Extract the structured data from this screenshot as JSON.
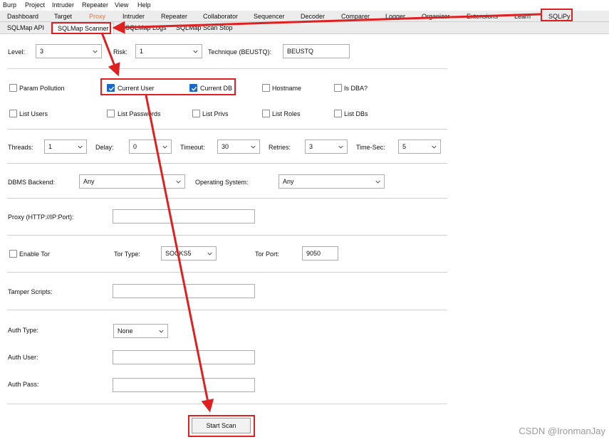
{
  "menubar": [
    "Burp",
    "Project",
    "Intruder",
    "Repeater",
    "View",
    "Help"
  ],
  "tabs": [
    "Dashboard",
    "Target",
    "Proxy",
    "Intruder",
    "Repeater",
    "Collaborator",
    "Sequencer",
    "Decoder",
    "Comparer",
    "Logger",
    "Organizer",
    "Extensions",
    "Learn",
    "SQLiPy"
  ],
  "subtabs": [
    "SQLMap API",
    "SQLMap Scanner",
    "SQLMap Logs",
    "SQLMap Scan Stop"
  ],
  "row1": {
    "level_label": "Level:",
    "level_value": "3",
    "risk_label": "Risk:",
    "risk_value": "1",
    "technique_label": "Technique (BEUSTQ):",
    "technique_value": "BEUSTQ"
  },
  "checks": {
    "param_pollution": "Param Pollution",
    "current_user": "Current User",
    "current_db": "Current DB",
    "hostname": "Hostname",
    "is_dba": "Is DBA?",
    "list_users": "List Users",
    "list_passwords": "List Passwords",
    "list_privs": "List Privs",
    "list_roles": "List Roles",
    "list_dbs": "List DBs"
  },
  "row3": {
    "threads_label": "Threads:",
    "threads_value": "1",
    "delay_label": "Delay:",
    "delay_value": "0",
    "timeout_label": "Timeout:",
    "timeout_value": "30",
    "retries_label": "Retries:",
    "retries_value": "3",
    "timesec_label": "Time-Sec:",
    "timesec_value": "5"
  },
  "dbms": {
    "label": "DBMS Backend:",
    "value": "Any",
    "os_label": "Operating System:",
    "os_value": "Any"
  },
  "proxy": {
    "label": "Proxy (HTTP://IP:Port):",
    "value": ""
  },
  "tor": {
    "enable_label": "Enable Tor",
    "type_label": "Tor Type:",
    "type_value": "SOCKS5",
    "port_label": "Tor Port:",
    "port_value": "9050"
  },
  "tamper": {
    "label": "Tamper Scripts:",
    "value": ""
  },
  "auth": {
    "type_label": "Auth Type:",
    "type_value": "None",
    "user_label": "Auth User:",
    "user_value": "",
    "pass_label": "Auth Pass:",
    "pass_value": ""
  },
  "start_button": "Start Scan",
  "watermark": "CSDN @IronmanJay",
  "colors": {
    "annotation_red": "#e02020",
    "checkbox_blue": "#1b68c8",
    "active_tab": "#e8733c"
  }
}
